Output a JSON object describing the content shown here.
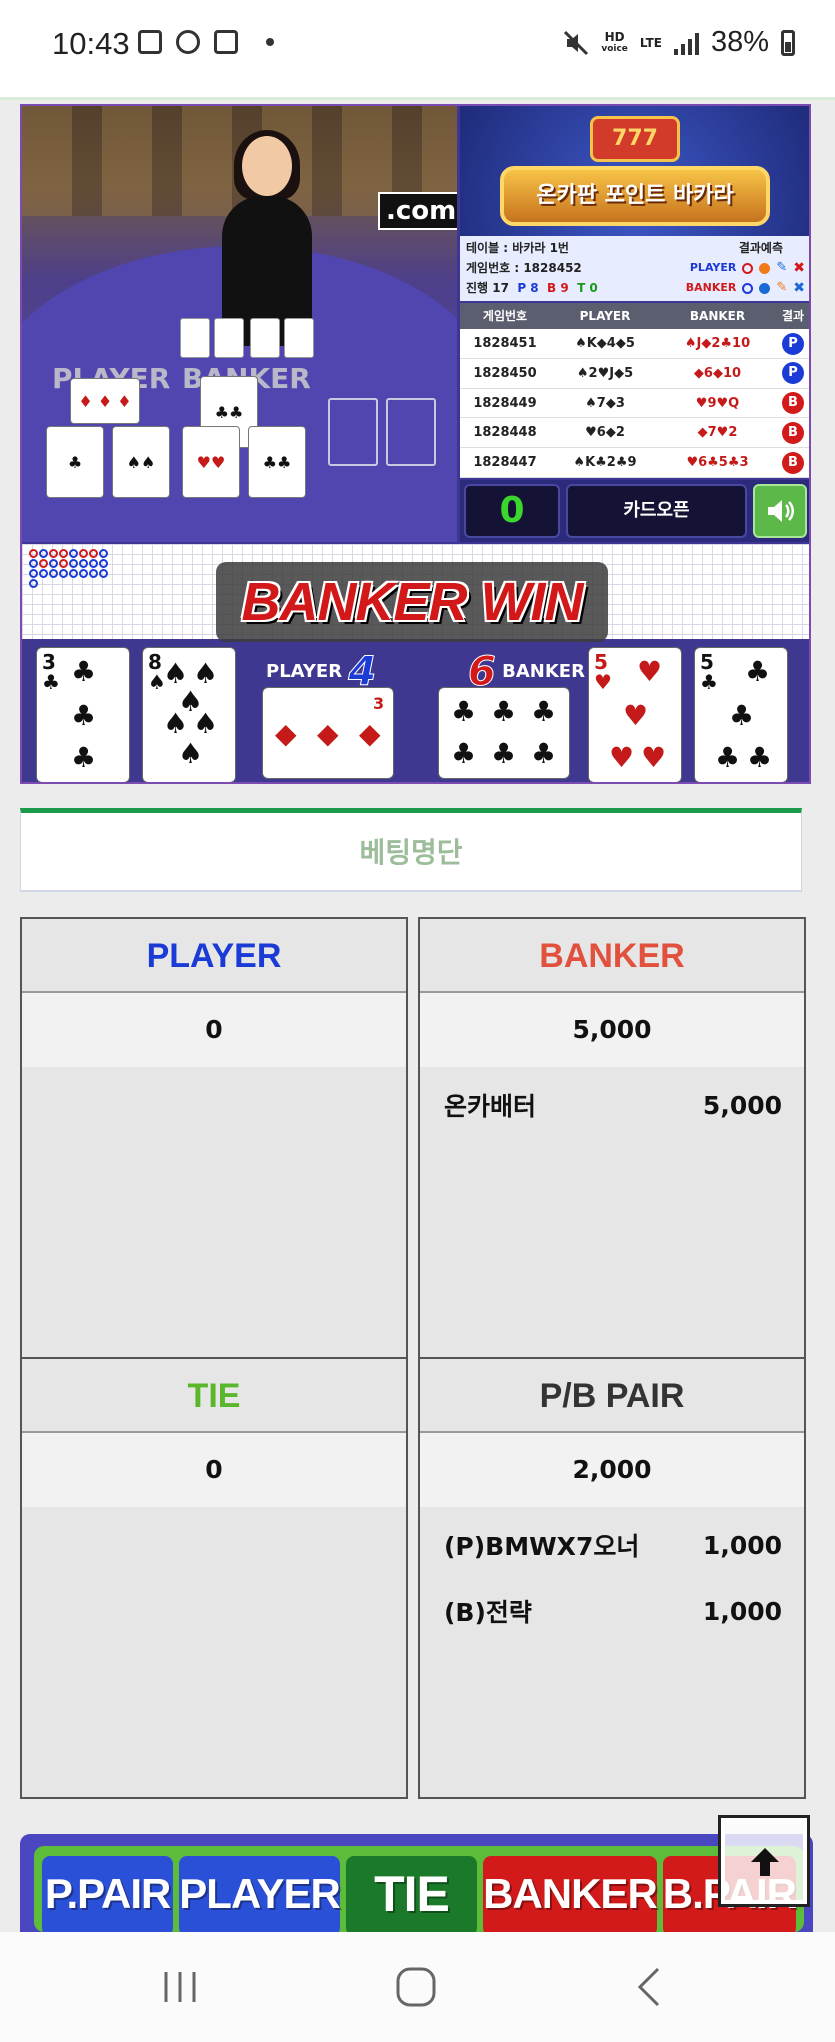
{
  "status_bar": {
    "time": "10:43",
    "network_top": "HD",
    "network_bottom": "voice",
    "lte": "LTE",
    "battery": "38%"
  },
  "game": {
    "video_logo": ".com",
    "video_player_label": "PLAYER",
    "video_banker_label": "BANKER",
    "promo_slot": "777",
    "promo_title": "온카판 포인트 바카라",
    "table_label": "테이블 : 바카라 1번",
    "prediction_label": "결과예측",
    "game_no_label": "게임번호 : 1828452",
    "progress_label": "진행 17",
    "progress_p": "P 8",
    "progress_b": "B 9",
    "progress_t": "T 0",
    "pred_player": "PLAYER",
    "pred_banker": "BANKER",
    "results_headers": [
      "게임번호",
      "PLAYER",
      "BANKER",
      "결과"
    ],
    "results": [
      {
        "no": "1828451",
        "player": "♠K◆4◆5",
        "banker": "♠J◆2♣10",
        "result": "P"
      },
      {
        "no": "1828450",
        "player": "♠2♥J◆5",
        "banker": "◆6◆10",
        "result": "P"
      },
      {
        "no": "1828449",
        "player": "♠7◆3",
        "banker": "♥9♥Q",
        "result": "B"
      },
      {
        "no": "1828448",
        "player": "♥6◆2",
        "banker": "◆7♥2",
        "result": "B"
      },
      {
        "no": "1828447",
        "player": "♠K♣2♣9",
        "banker": "♥6♣5♣3",
        "result": "B"
      }
    ],
    "card_count": "0",
    "card_open_label": "카드오픈",
    "win_text": "BANKER WIN",
    "player_label": "PLAYER",
    "player_score": "4",
    "banker_label": "BANKER",
    "banker_score": "6",
    "player_cards": [
      {
        "rank": "3",
        "suit": "♣",
        "color": "black"
      },
      {
        "rank": "8",
        "suit": "♠",
        "color": "black"
      },
      {
        "rank": "3",
        "suit": "◆",
        "color": "red"
      }
    ],
    "banker_cards": [
      {
        "rank": "6",
        "suit": "♣",
        "color": "black"
      },
      {
        "rank": "5",
        "suit": "♥",
        "color": "red"
      },
      {
        "rank": "5",
        "suit": "♣",
        "color": "black"
      }
    ]
  },
  "betting": {
    "header": "베팅명단",
    "panels": {
      "player": {
        "title": "PLAYER",
        "total": "0",
        "entries": []
      },
      "banker": {
        "title": "BANKER",
        "total": "5,000",
        "entries": [
          {
            "name": "온카배터",
            "amount": "5,000"
          }
        ]
      },
      "tie": {
        "title": "TIE",
        "total": "0",
        "entries": []
      },
      "pair": {
        "title": "P/B PAIR",
        "total": "2,000",
        "entries": [
          {
            "name": "(P)BMWX7오너",
            "amount": "1,000"
          },
          {
            "name": "(B)전략",
            "amount": "1,000"
          }
        ]
      }
    }
  },
  "bet_buttons": {
    "p_pair": "P.PAIR",
    "player": "PLAYER",
    "tie": "TIE",
    "banker": "BANKER",
    "b_pair": "B.PAIR"
  },
  "colors": {
    "player": "#1a3bd6",
    "banker": "#e2503e",
    "tie": "#5ab62a",
    "header_accent": "#1a9a4a"
  }
}
